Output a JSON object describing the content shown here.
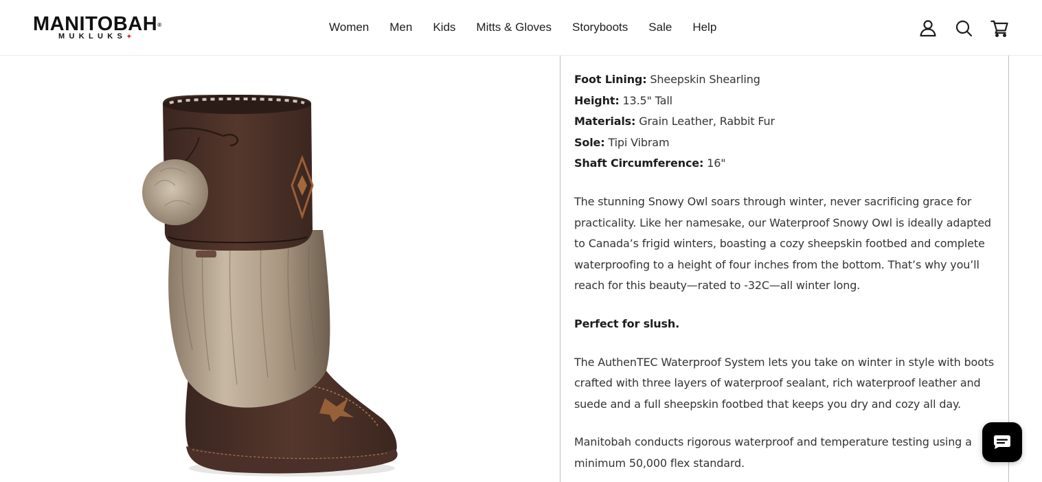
{
  "header": {
    "logo": {
      "main": "MANITOBAH",
      "registered": "®",
      "sub": "MUKLUKS"
    },
    "nav": [
      "Women",
      "Men",
      "Kids",
      "Mitts & Gloves",
      "Storyboots",
      "Sale",
      "Help"
    ],
    "icons": [
      "account-icon",
      "search-icon",
      "cart-icon"
    ]
  },
  "product": {
    "image_alt": "Waterproof Snowy Owl mukluk boot with rabbit fur",
    "specs": [
      {
        "label": "Foot Lining:",
        "value": "Sheepskin Shearling"
      },
      {
        "label": "Height:",
        "value": "13.5\" Tall"
      },
      {
        "label": "Materials:",
        "value": "Grain Leather, Rabbit Fur"
      },
      {
        "label": "Sole:",
        "value": "Tipi Vibram"
      },
      {
        "label": "Shaft Circumference:",
        "value": "16\""
      }
    ],
    "paragraphs": [
      "The stunning Snowy Owl soars through winter, never sacrificing grace for practicality. Like her namesake, our Waterproof Snowy Owl is ideally adapted to Canada’s frigid winters, boasting a cozy sheepskin footbed and complete waterproofing to a height of four inches from the bottom. That’s why you’ll reach for this beauty—rated to -32C—all winter long.",
      "Perfect for slush.",
      "The AuthenTEC Waterproof System lets you take on winter in style with boots crafted with three layers of waterproof sealant, rich waterproof leather and suede and a full sheepskin footbed that keeps you dry and cozy all day.",
      "Manitobah conducts rigorous waterproof and temperature testing using a minimum 50,000 flex standard."
    ]
  },
  "chat": {
    "icon": "chat-icon"
  },
  "colors": {
    "text": "#1c1d1d",
    "body_text": "#333333",
    "border": "#bfbfbf",
    "brand_red": "#d4232b"
  }
}
